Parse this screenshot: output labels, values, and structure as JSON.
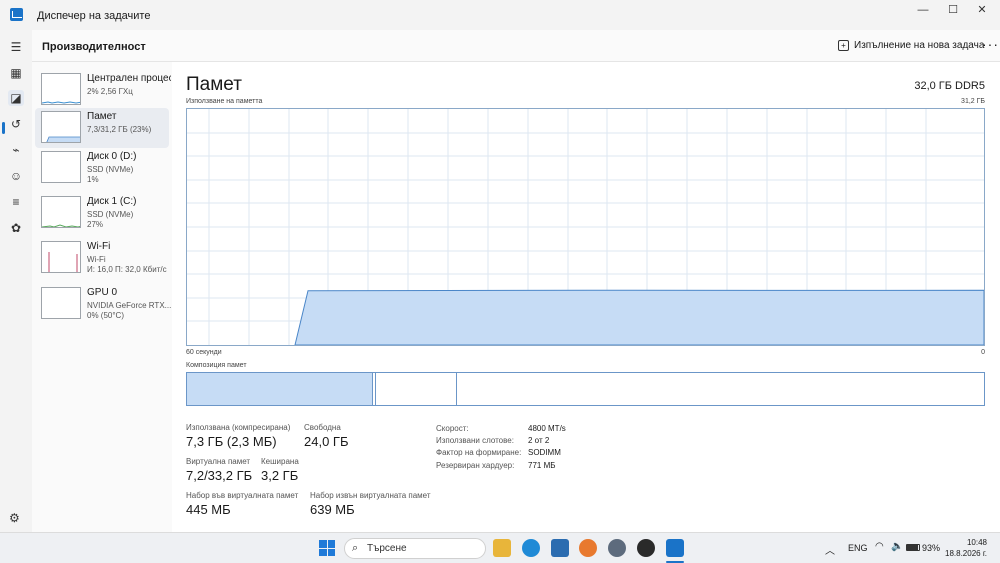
{
  "app": {
    "title": "Диспечер на задачите",
    "window_controls": {
      "minimize": "—",
      "maximize": "☐",
      "close": "✕"
    }
  },
  "header": {
    "title": "Производителност",
    "run_task_label": "Изпълнение на нова задача",
    "more_label": "···"
  },
  "resources": [
    {
      "name": "Централен процесор",
      "sub1": "2% 2,56 ГХц",
      "sub2": ""
    },
    {
      "name": "Памет",
      "sub1": "7,3/31,2 ГБ (23%)",
      "sub2": ""
    },
    {
      "name": "Диск 0 (D:)",
      "sub1": "SSD (NVMe)",
      "sub2": "1%"
    },
    {
      "name": "Диск 1 (C:)",
      "sub1": "SSD (NVMe)",
      "sub2": "27%"
    },
    {
      "name": "Wi-Fi",
      "sub1": "Wi-Fi",
      "sub2": "И: 16,0 П: 32,0 Кбит/с"
    },
    {
      "name": "GPU 0",
      "sub1": "NVIDIA GeForce RTX...",
      "sub2": "0% (50°C)"
    }
  ],
  "main": {
    "title": "Памет",
    "spec": "32,0 ГБ DDR5",
    "usage_label": "Използване на паметта",
    "usage_max": "31,2 ГБ",
    "time_left": "60 секунди",
    "time_right": "0",
    "composition_label": "Композиция памет",
    "usage_fraction_current": 0.23,
    "composition": {
      "in_use_fraction": 0.234,
      "modified_fraction": 0.004,
      "standby_fraction": 0.1
    }
  },
  "stats": {
    "in_use_label": "Използвана (компресирана)",
    "in_use_value": "7,3 ГБ (2,3 МБ)",
    "available_label": "Свободна",
    "available_value": "24,0 ГБ",
    "committed_label": "Виртуална памет",
    "committed_value": "7,2/33,2 ГБ",
    "cached_label": "Кеширана",
    "cached_value": "3,2 ГБ",
    "paged_label": "Набор във виртуалната памет",
    "paged_value": "445 МБ",
    "nonpaged_label": "Набор извън виртуалната памет",
    "nonpaged_value": "639 МБ"
  },
  "specs": [
    {
      "label": "Скорост:",
      "value": "4800 MT/s"
    },
    {
      "label": "Използвани слотове:",
      "value": "2 от 2"
    },
    {
      "label": "Фактор на формиране:",
      "value": "SODIMM"
    },
    {
      "label": "Резервиран хардуер:",
      "value": "771 МБ"
    }
  ],
  "taskbar": {
    "search_placeholder": "Търсене",
    "language": "ENG",
    "battery": "93%",
    "time": "10:48",
    "date": "18.8.2026 г."
  },
  "colors": {
    "accent": "#1a73c8",
    "graph_fill": "#c6dcf5",
    "graph_line": "#4a86c8"
  }
}
